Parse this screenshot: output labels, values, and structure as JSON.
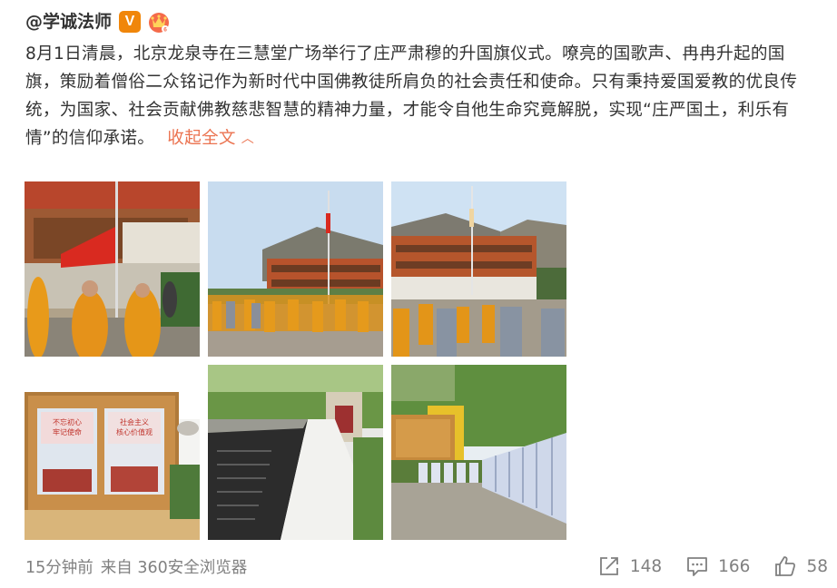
{
  "post": {
    "author": "@学诚法师",
    "verified_badge": "V",
    "content": "8月1日清晨，北京龙泉寺在三慧堂广场举行了庄严肃穆的升国旗仪式。嘹亮的国歌声、冉冉升起的国旗，策励着僧俗二众铭记作为新时代中国佛教徒所肩负的社会责任和使命。只有秉持爱国爱教的优良传统，为国家、社会贡献佛教慈悲智慧的精神力量，才能令自他生命究竟解脱，实现“庄严国土，利乐有情”的信仰承诺。",
    "collapse_label": "收起全文",
    "collapse_icon": "chevron-up-icon",
    "images": [
      {
        "name": "photo-flag-raising-closeup",
        "board_text_1": "",
        "board_text_2": ""
      },
      {
        "name": "photo-temple-ceremony-wide",
        "board_text_1": "",
        "board_text_2": ""
      },
      {
        "name": "photo-temple-mountains",
        "board_text_1": "",
        "board_text_2": ""
      },
      {
        "name": "photo-display-board",
        "board_text_1": "不忘初心\n牢记使命",
        "board_text_2": "社会主义\n核心价值观"
      },
      {
        "name": "photo-stone-wall",
        "board_text_1": "",
        "board_text_2": ""
      },
      {
        "name": "photo-exhibition-panels",
        "board_text_1": "",
        "board_text_2": ""
      }
    ],
    "time": "15分钟前",
    "source": "来自 360安全浏览器",
    "repost_count": "148",
    "comment_count": "166",
    "like_count": "58"
  },
  "colors": {
    "accent": "#eb7350",
    "badge": "#f0860a",
    "text": "#333333",
    "muted": "#808080"
  }
}
